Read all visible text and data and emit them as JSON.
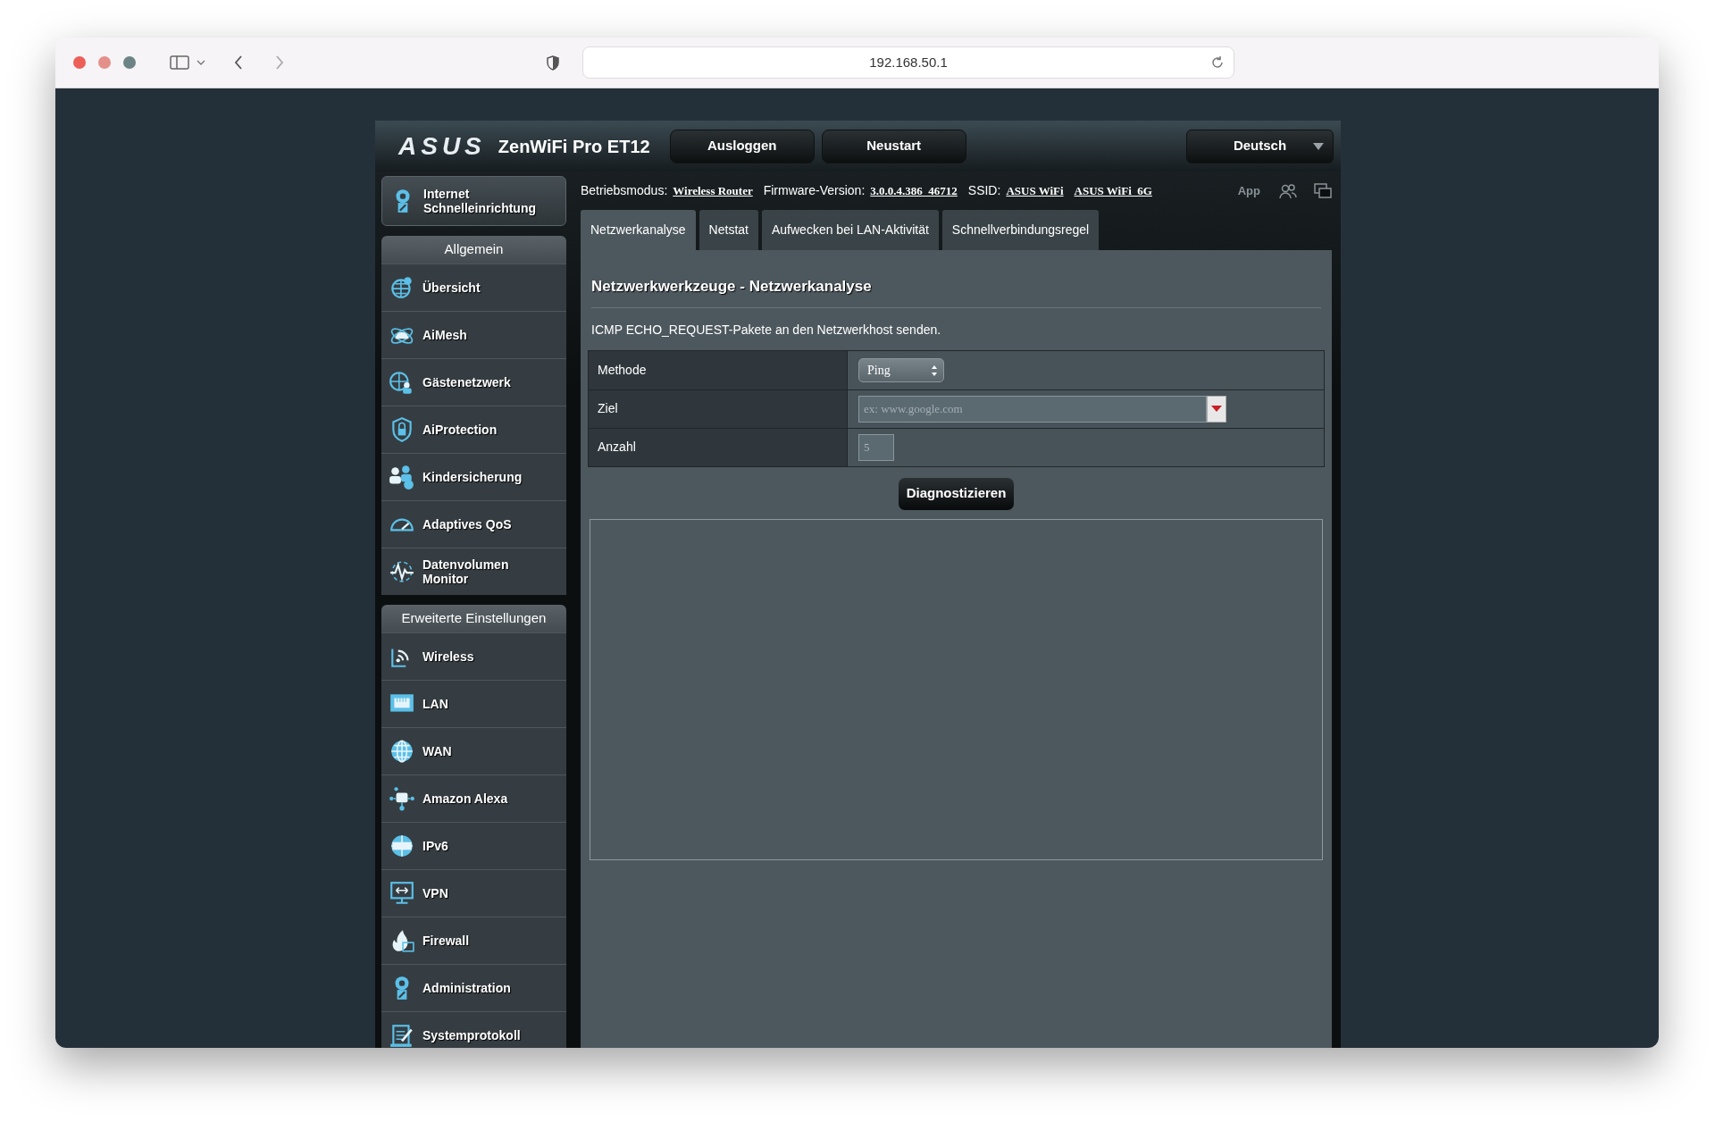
{
  "browser": {
    "url": "192.168.50.1"
  },
  "header": {
    "logo": "ASUS",
    "product": "ZenWiFi Pro ET12",
    "buttons": [
      "Ausloggen",
      "Neustart"
    ],
    "language": "Deutsch"
  },
  "quick_setup": {
    "label": "Internet Schnelleinrichtung"
  },
  "sidebar": {
    "sections": [
      {
        "title": "Allgemein",
        "items": [
          {
            "label": "Übersicht"
          },
          {
            "label": "AiMesh"
          },
          {
            "label": "Gästenetzwerk"
          },
          {
            "label": "AiProtection"
          },
          {
            "label": "Kindersicherung"
          },
          {
            "label": "Adaptives QoS"
          },
          {
            "label": "Datenvolumen Monitor"
          }
        ]
      },
      {
        "title": "Erweiterte Einstellungen",
        "items": [
          {
            "label": "Wireless"
          },
          {
            "label": "LAN"
          },
          {
            "label": "WAN"
          },
          {
            "label": "Amazon Alexa"
          },
          {
            "label": "IPv6"
          },
          {
            "label": "VPN"
          },
          {
            "label": "Firewall"
          },
          {
            "label": "Administration"
          },
          {
            "label": "Systemprotokoll"
          }
        ]
      }
    ]
  },
  "info_bar": {
    "items": [
      {
        "label": "Betriebsmodus:",
        "links": [
          "Wireless Router"
        ]
      },
      {
        "label": "Firmware-Version:",
        "links": [
          "3.0.0.4.386_46712"
        ]
      },
      {
        "label": "SSID:",
        "links": [
          "ASUS WiFi",
          "ASUS WiFi_6G"
        ]
      }
    ],
    "app": "App"
  },
  "tabs": [
    {
      "label": "Netzwerkanalyse",
      "selected": true
    },
    {
      "label": "Netstat",
      "selected": false
    },
    {
      "label": "Aufwecken bei LAN-Aktivität",
      "selected": false
    },
    {
      "label": "Schnellverbindungsregel",
      "selected": false
    }
  ],
  "panel": {
    "title": "Netzwerkwerkzeuge - Netzwerkanalyse",
    "description": "ICMP ECHO_REQUEST-Pakete an den Netzwerkhost senden.",
    "rows": [
      {
        "label": "Methode",
        "kind": "select",
        "value": "Ping"
      },
      {
        "label": "Ziel",
        "kind": "combo",
        "placeholder": "ex: www.google.com"
      },
      {
        "label": "Anzahl",
        "kind": "input",
        "value": "5"
      }
    ],
    "button": "Diagnostizieren"
  }
}
